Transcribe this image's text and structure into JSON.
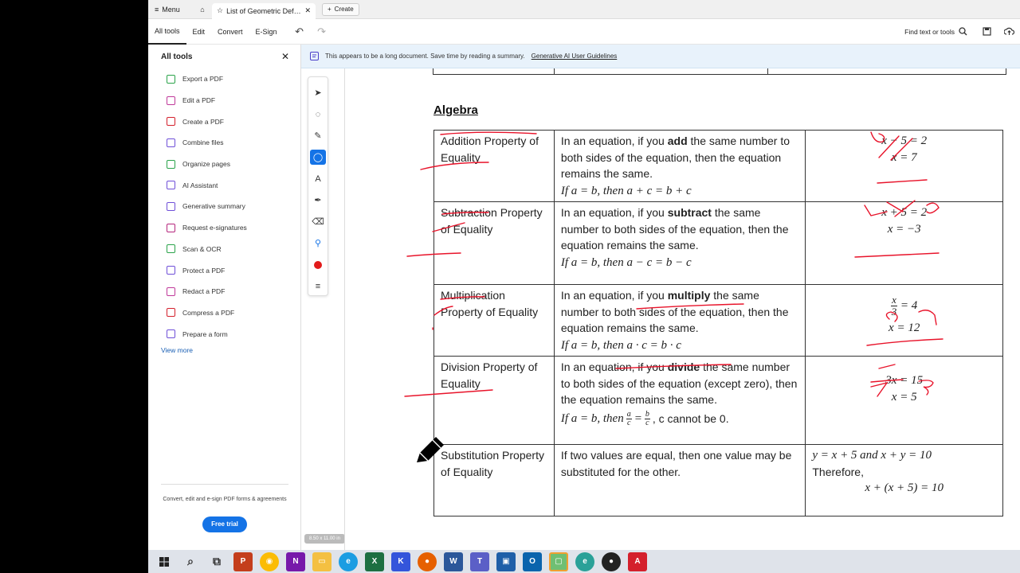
{
  "tabbar": {
    "menu_label": "Menu",
    "doc_tab_title": "List of Geometric Definit...",
    "create_label": "Create"
  },
  "toolbar": {
    "tabs": [
      "All tools",
      "Edit",
      "Convert",
      "E-Sign"
    ],
    "find_label": "Find text or tools"
  },
  "left_panel": {
    "title": "All tools",
    "items": [
      {
        "label": "Export a PDF",
        "color": "#2aa34a"
      },
      {
        "label": "Edit a PDF",
        "color": "#c0399a"
      },
      {
        "label": "Create a PDF",
        "color": "#d4202c"
      },
      {
        "label": "Combine files",
        "color": "#6f4fd8"
      },
      {
        "label": "Organize pages",
        "color": "#2aa34a"
      },
      {
        "label": "AI Assistant",
        "color": "#6f4fd8"
      },
      {
        "label": "Generative summary",
        "color": "#6f4fd8"
      },
      {
        "label": "Request e-signatures",
        "color": "#b5257c"
      },
      {
        "label": "Scan & OCR",
        "color": "#2aa34a"
      },
      {
        "label": "Protect a PDF",
        "color": "#6f4fd8"
      },
      {
        "label": "Redact a PDF",
        "color": "#c0399a"
      },
      {
        "label": "Compress a PDF",
        "color": "#d4202c"
      },
      {
        "label": "Prepare a form",
        "color": "#6f4fd8"
      }
    ],
    "view_more": "View more",
    "footer_text": "Convert, edit and e-sign PDF forms & agreements",
    "free_trial": "Free trial"
  },
  "banner": {
    "text": "This appears to be a long document. Save time by reading a summary.",
    "link": "Generative AI User Guidelines"
  },
  "document": {
    "heading": "Algebra",
    "page_size": "8.50 x 11.00 in",
    "rows": [
      {
        "name": "Addition Property of Equality",
        "desc_pre": "In an equation, if you ",
        "desc_bold": "add",
        "desc_post": " the same number to both sides of the equation, then the equation remains the same.",
        "rule": "If a = b, then a + c = b + c"
      },
      {
        "name": "Subtraction Property of Equality",
        "desc_pre": "In an equation, if you ",
        "desc_bold": "subtract",
        "desc_post": " the same number to both sides of the equation, then the equation remains the same.",
        "rule": "If a = b, then a − c = b − c"
      },
      {
        "name": "Multiplication Property of Equality",
        "desc_pre": "In an equation, if you ",
        "desc_bold": "multiply",
        "desc_post": " the same number to both sides of the equation, then the equation remains the same.",
        "rule": "If a = b, then a · c = b · c"
      },
      {
        "name": "Division Property of Equality",
        "desc_pre": "In an equation, if you ",
        "desc_bold": "divide",
        "desc_post": " the same number to both sides of the equation (except zero), then the equation remains the same.",
        "rule_pre": "If a = b, then",
        "rule_post": ", c cannot be 0."
      },
      {
        "name": "Substitution Property of Equality",
        "desc": "If two values are equal, then one value may be substituted for the other."
      }
    ],
    "examples": {
      "addition": [
        "x − 5 = 2",
        "x = 7"
      ],
      "subtraction": [
        "x + 5 = 2",
        "x = −3"
      ],
      "multiplication": [
        "x",
        "3",
        "= 4",
        "x = 12"
      ],
      "division": [
        "3x = 15",
        "x = 5"
      ],
      "substitution": [
        "y = x + 5 and x + y = 10",
        "Therefore,",
        "x + (x + 5) = 10"
      ]
    },
    "ink_annotations": [
      "+5",
      "+5",
      "-5",
      "-5",
      "3",
      "3"
    ]
  },
  "colors": {
    "ink": "#e8132a",
    "accent": "#1473e6",
    "banner_bg": "#e8f2fb"
  }
}
